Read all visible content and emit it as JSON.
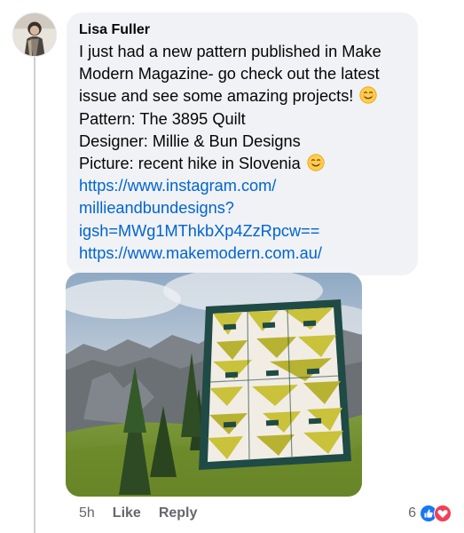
{
  "comment": {
    "author": "Lisa Fuller",
    "lines": [
      "I just had a new pattern published in Make",
      "Modern Magazine- go check out the latest",
      "issue and see some amazing projects!",
      "Pattern: The 3895 Quilt",
      "Designer: Millie & Bun Designs",
      "Picture: recent hike in Slovenia"
    ],
    "links": [
      "https://www.instagram.com/",
      "millieandbundesigns?",
      "igsh=MWg1MThkbXp4ZzRpcw==",
      "https://www.makemodern.com.au/"
    ],
    "emoji": "smiling-face-icon"
  },
  "photo": {
    "subject": "quilt-photo"
  },
  "actions": {
    "time": "5h",
    "like": "Like",
    "reply": "Reply"
  },
  "reactions": {
    "count": "6",
    "types": [
      "like-reaction-icon",
      "love-reaction-icon"
    ],
    "colors": {
      "like": "#1877f2",
      "love": "#f33e58"
    }
  },
  "colors": {
    "bubble": "#f0f2f5",
    "link": "#0064d1",
    "meta": "#65676b",
    "text": "#050505"
  }
}
